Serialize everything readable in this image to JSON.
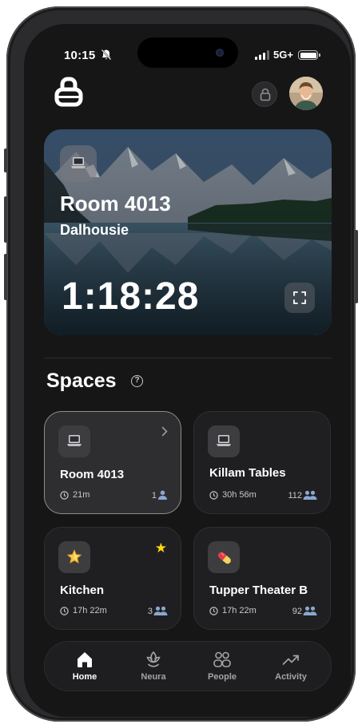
{
  "status_bar": {
    "time": "10:15",
    "network": "5G+"
  },
  "hero": {
    "title": "Room 4013",
    "subtitle": "Dalhousie",
    "timer": "1:18:28",
    "icon": "laptop-icon"
  },
  "spaces": {
    "title": "Spaces",
    "help_glyph": "?",
    "cards": [
      {
        "name": "Room 4013",
        "duration": "21m",
        "count": "1",
        "icon": "laptop-icon",
        "selected": true,
        "badge": "chevron-right-icon"
      },
      {
        "name": "Killam Tables",
        "duration": "30h 56m",
        "count": "112",
        "icon": "laptop-icon",
        "selected": false
      },
      {
        "name": "Kitchen",
        "duration": "17h 22m",
        "count": "3",
        "icon": "sparkle-star-icon",
        "selected": false,
        "badge": "star-icon"
      },
      {
        "name": "Tupper Theater B",
        "duration": "17h 22m",
        "count": "92",
        "icon": "pill-icon",
        "selected": false
      }
    ],
    "star_glyph": "★"
  },
  "tabs": [
    {
      "label": "Home",
      "icon": "home-icon",
      "active": true
    },
    {
      "label": "Neura",
      "icon": "lotus-icon",
      "active": false
    },
    {
      "label": "People",
      "icon": "people-icon",
      "active": false
    },
    {
      "label": "Activity",
      "icon": "trend-icon",
      "active": false
    }
  ],
  "colors": {
    "background": "#161617",
    "card": "#1f1f21",
    "accent_star": "#ffd60a",
    "text": "#ffffff",
    "muted": "#a4a4a8"
  }
}
